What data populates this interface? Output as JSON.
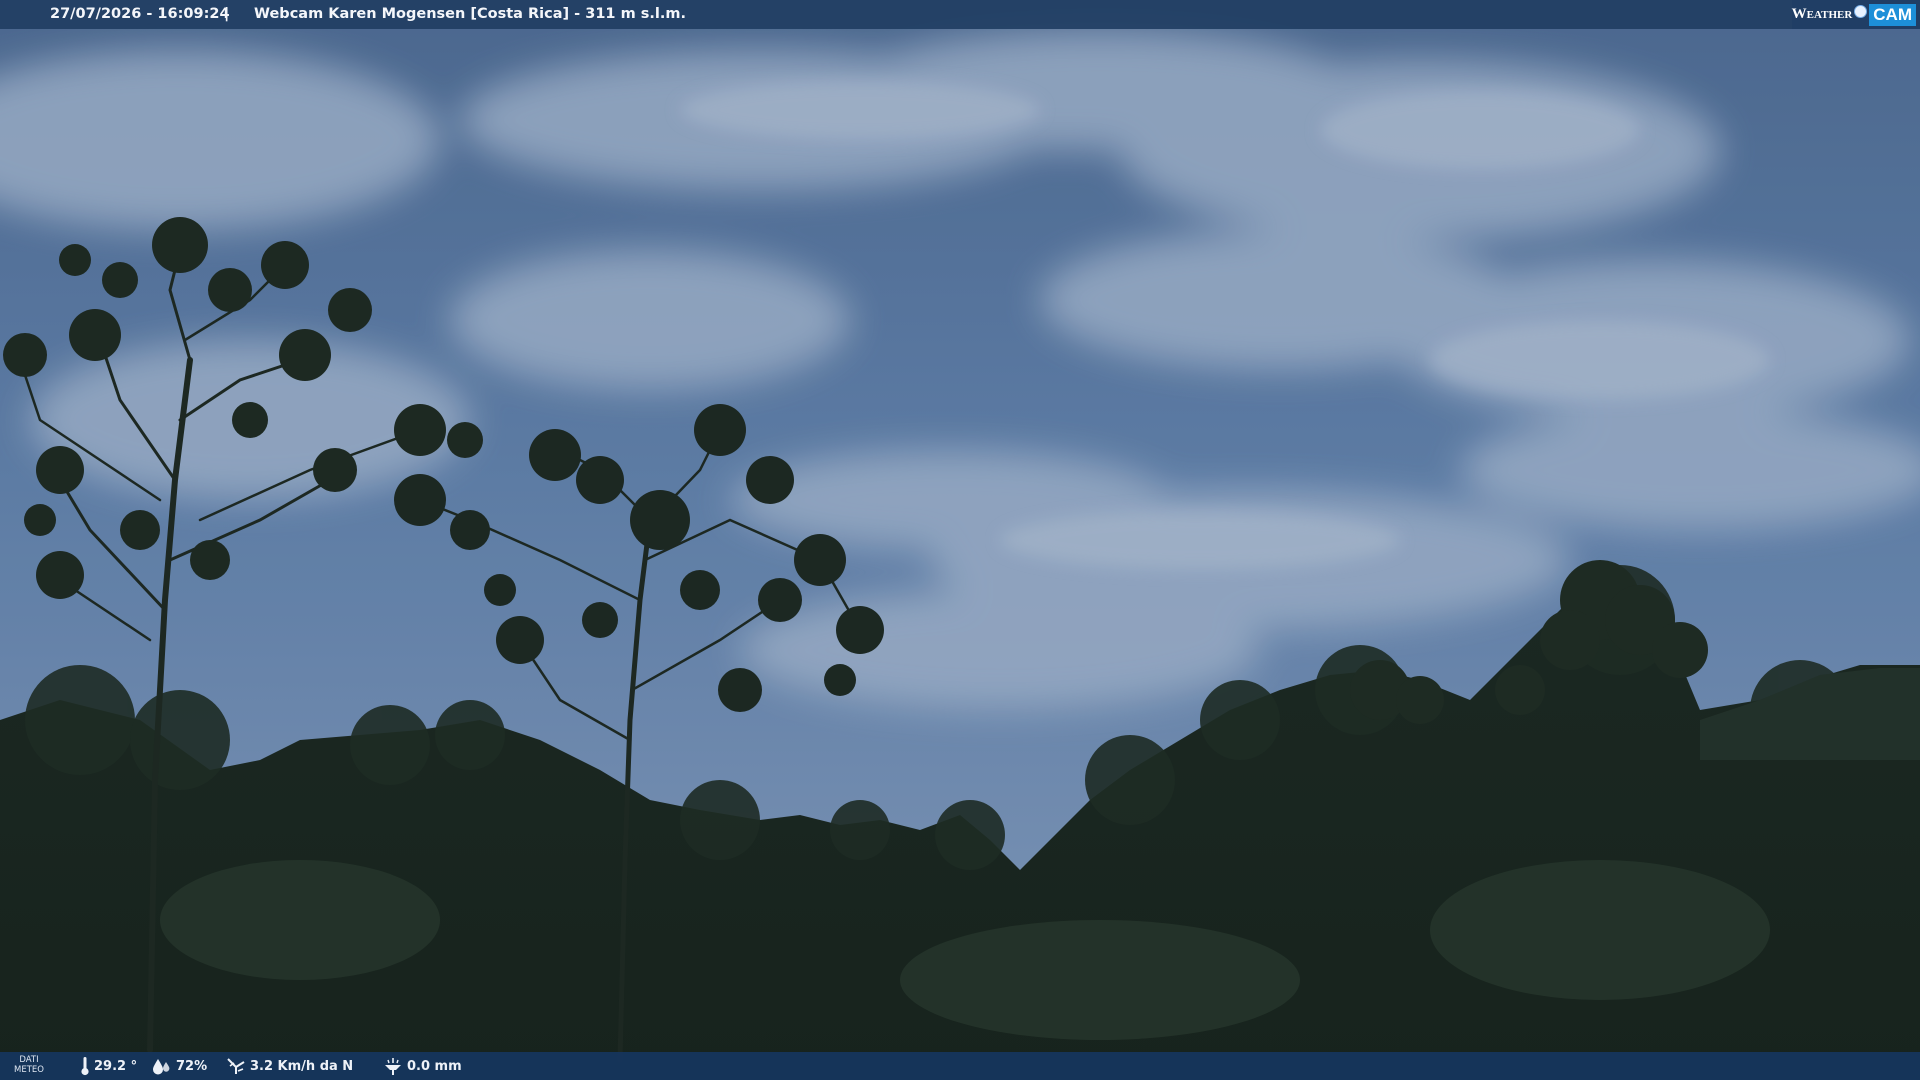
{
  "top_bar": {
    "datetime": "27/07/2026 - 16:09:24",
    "separator": "|",
    "webcam_title": "Webcam Karen Mogensen [Costa Rica]  - 311 m s.l.m."
  },
  "logo": {
    "weather": "Weather",
    "cam": "CAM"
  },
  "bottom_bar": {
    "label_line1": "DATI",
    "label_line2": "METEO",
    "temperature": "29.2 °",
    "humidity": "72%",
    "wind": "3.2 Km/h da N",
    "rain": "0.0 mm"
  },
  "icons": {
    "temperature": "thermometer-icon",
    "humidity": "humidity-drop-icon",
    "wind": "wind-icon",
    "rain": "rain-gauge-icon"
  },
  "colors": {
    "bar_background": "#213e63",
    "logo_accent": "#1d8fd8",
    "text": "#f4f6fa"
  }
}
